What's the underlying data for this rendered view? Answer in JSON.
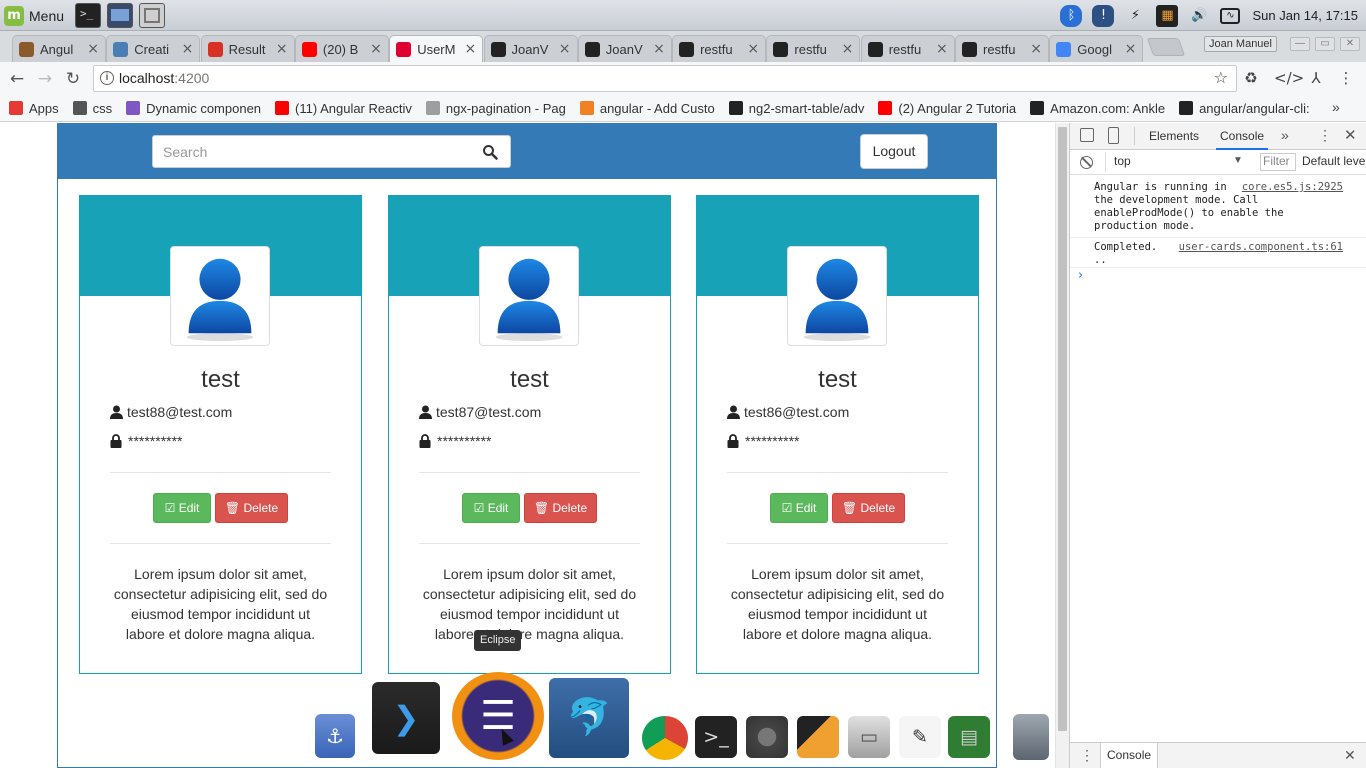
{
  "system": {
    "menu_label": "Menu",
    "clock": "Sun Jan 14, 17:15",
    "launchers": [
      "terminal-launcher",
      "desktop-launcher",
      "files-launcher"
    ]
  },
  "browser": {
    "tabs": [
      {
        "title": "Angul",
        "icon": "angular-tab-icon",
        "color": "#8a5a2b"
      },
      {
        "title": "Creati",
        "icon": "web-tab-icon",
        "color": "#4a7fb5"
      },
      {
        "title": "Result",
        "icon": "gmail-icon",
        "color": "#d93025"
      },
      {
        "title": "(20) B",
        "icon": "youtube-icon",
        "color": "#ff0000"
      },
      {
        "title": "UserM",
        "icon": "angular-icon",
        "color": "#dd0031",
        "active": true
      },
      {
        "title": "JoanV",
        "icon": "github-icon",
        "color": "#222222"
      },
      {
        "title": "JoanV",
        "icon": "github-icon",
        "color": "#222222"
      },
      {
        "title": "restfu",
        "icon": "github-icon",
        "color": "#222222"
      },
      {
        "title": "restfu",
        "icon": "github-icon",
        "color": "#222222"
      },
      {
        "title": "restfu",
        "icon": "github-icon",
        "color": "#222222"
      },
      {
        "title": "restfu",
        "icon": "github-icon",
        "color": "#222222"
      },
      {
        "title": "Googl",
        "icon": "google-icon",
        "color": "#4285f4"
      }
    ],
    "profile_name": "Joan Manuel",
    "url_host": "localhost",
    "url_port": ":4200",
    "bookmarks": [
      {
        "label": "Apps",
        "icon": "apps-grid-icon",
        "color": "#e53935"
      },
      {
        "label": "css",
        "icon": "folder-icon",
        "color": "#555555"
      },
      {
        "label": "Dynamic componen",
        "icon": "bookmark-site-icon",
        "color": "#7e57c2"
      },
      {
        "label": "(11) Angular Reactiv",
        "icon": "youtube-icon",
        "color": "#ff0000"
      },
      {
        "label": "ngx-pagination - Pag",
        "icon": "page-icon",
        "color": "#9e9e9e"
      },
      {
        "label": "angular - Add Custo",
        "icon": "stackoverflow-icon",
        "color": "#f48024"
      },
      {
        "label": "ng2-smart-table/adv",
        "icon": "github-icon",
        "color": "#222222"
      },
      {
        "label": "(2) Angular 2 Tutoria",
        "icon": "youtube-icon",
        "color": "#ff0000"
      },
      {
        "label": "Amazon.com: Ankle",
        "icon": "amazon-icon",
        "color": "#222222"
      },
      {
        "label": "angular/angular-cli:",
        "icon": "github-icon",
        "color": "#222222"
      }
    ]
  },
  "app": {
    "search_placeholder": "Search",
    "logout_label": "Logout",
    "cards": [
      {
        "name": "test",
        "email": "test88@test.com",
        "password": "**********",
        "edit": "Edit",
        "delete": "Delete",
        "description": "Lorem ipsum dolor sit amet, consectetur adipisicing elit, sed do eiusmod tempor incididunt ut labore et dolore magna aliqua."
      },
      {
        "name": "test",
        "email": "test87@test.com",
        "password": "**********",
        "edit": "Edit",
        "delete": "Delete",
        "description": "Lorem ipsum dolor sit amet, consectetur adipisicing elit, sed do eiusmod tempor incididunt ut labore et dolore magna aliqua."
      },
      {
        "name": "test",
        "email": "test86@test.com",
        "password": "**********",
        "edit": "Edit",
        "delete": "Delete",
        "description": "Lorem ipsum dolor sit amet, consectetur adipisicing elit, sed do eiusmod tempor incididunt ut labore et dolore magna aliqua."
      }
    ],
    "colors": {
      "navbar": "#337ab7",
      "card_accent": "#17a2b8",
      "success": "#5cb85c",
      "danger": "#d9534f"
    }
  },
  "devtools": {
    "tabs": [
      "Elements",
      "Console"
    ],
    "active_tab": "Console",
    "context": "top",
    "filter_placeholder": "Filter",
    "level": "Default levels",
    "logs": [
      {
        "message": "Angular is running in the development mode. Call enableProdMode() to enable the production mode.",
        "source": "core.es5.js:2925"
      },
      {
        "message": "Completed. ..",
        "source": "user-cards.component.ts:61"
      }
    ],
    "drawer_tab": "Console"
  },
  "dock": {
    "tooltip": "Eclipse",
    "apps": [
      "anchor-app-icon",
      "vscode-icon",
      "eclipse-icon",
      "mysql-workbench-icon",
      "chrome-icon",
      "terminal-icon",
      "speaker-icon",
      "video-clapper-icon",
      "file-cabinet-icon",
      "text-editor-icon",
      "system-monitor-icon",
      "trash-icon"
    ]
  }
}
